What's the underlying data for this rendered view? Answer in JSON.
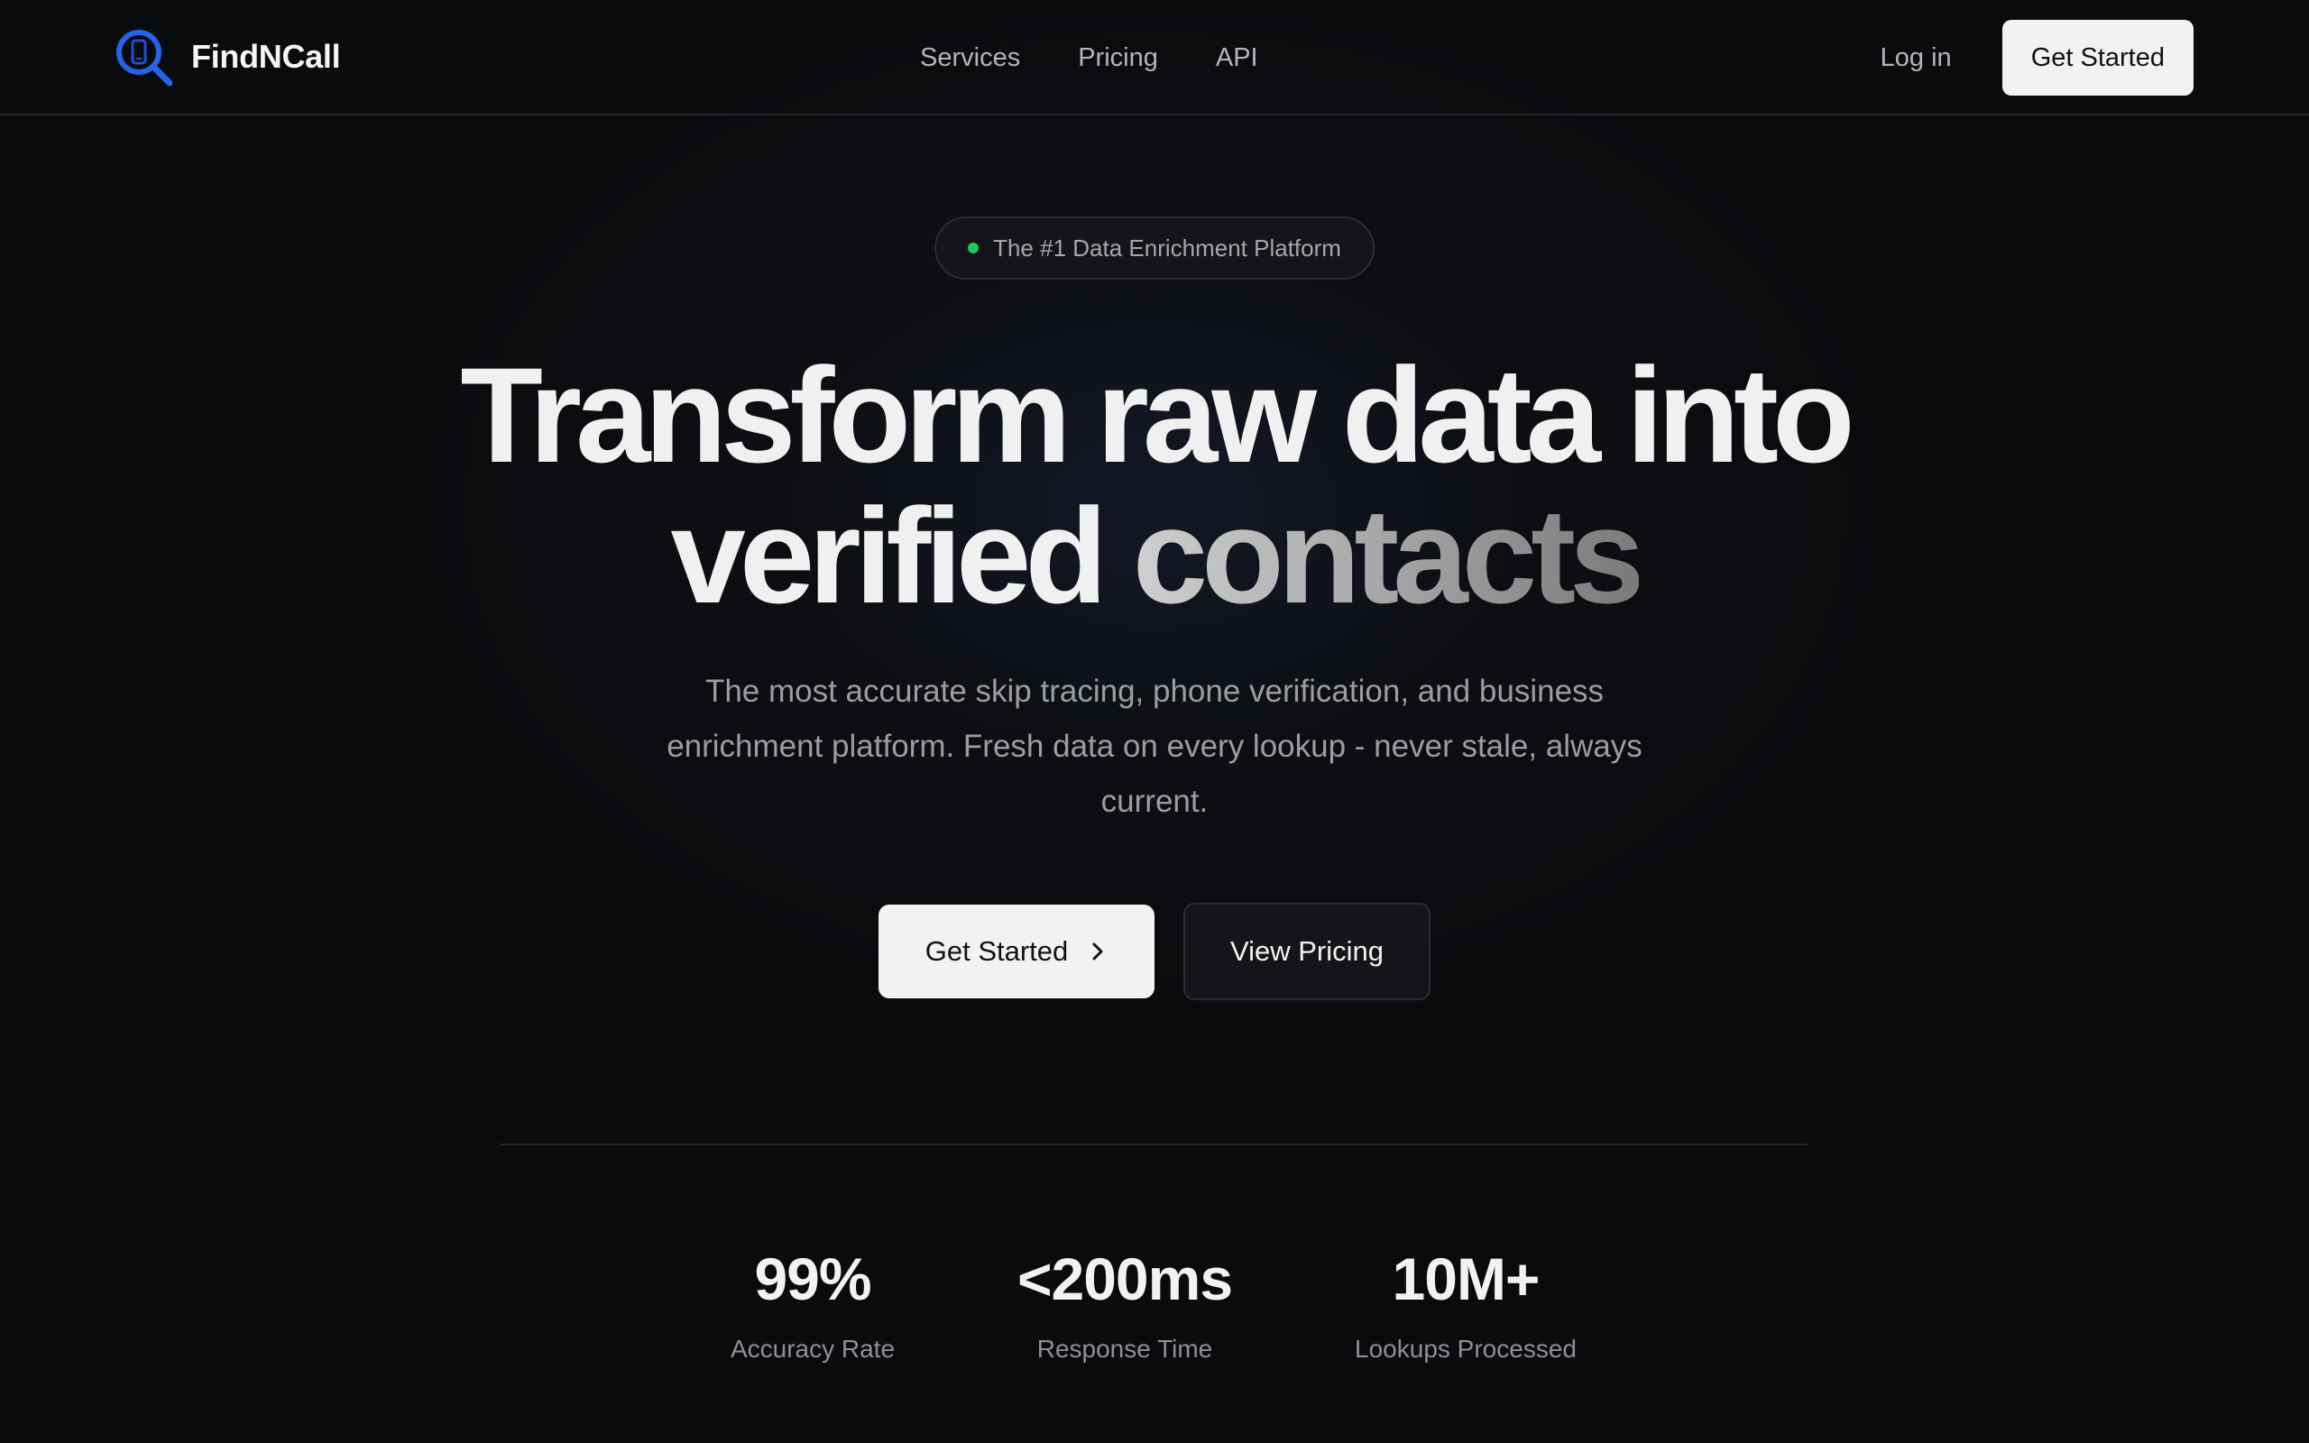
{
  "brand": {
    "name": "FindNCall",
    "logo_icon": "search-phone-icon",
    "accent_color": "#2563eb"
  },
  "nav": {
    "items": [
      {
        "label": "Services"
      },
      {
        "label": "Pricing"
      },
      {
        "label": "API"
      }
    ]
  },
  "header_actions": {
    "login_label": "Log in",
    "cta_label": "Get Started"
  },
  "hero": {
    "badge": {
      "text": "The #1 Data Enrichment Platform",
      "dot_color": "#22c55e"
    },
    "headline": {
      "line1": "Transform raw data into",
      "line2_a": "verified ",
      "line2_b": "contacts"
    },
    "subcopy": "The most accurate skip tracing, phone verification, and business enrichment platform. Fresh data on every lookup - never stale, always current.",
    "primary_cta": {
      "label": "Get Started",
      "icon": "chevron-right-icon"
    },
    "secondary_cta": {
      "label": "View Pricing"
    }
  },
  "stats": [
    {
      "value": "99%",
      "label": "Accuracy Rate"
    },
    {
      "value": "<200ms",
      "label": "Response Time"
    },
    {
      "value": "10M+",
      "label": "Lookups Processed"
    }
  ]
}
